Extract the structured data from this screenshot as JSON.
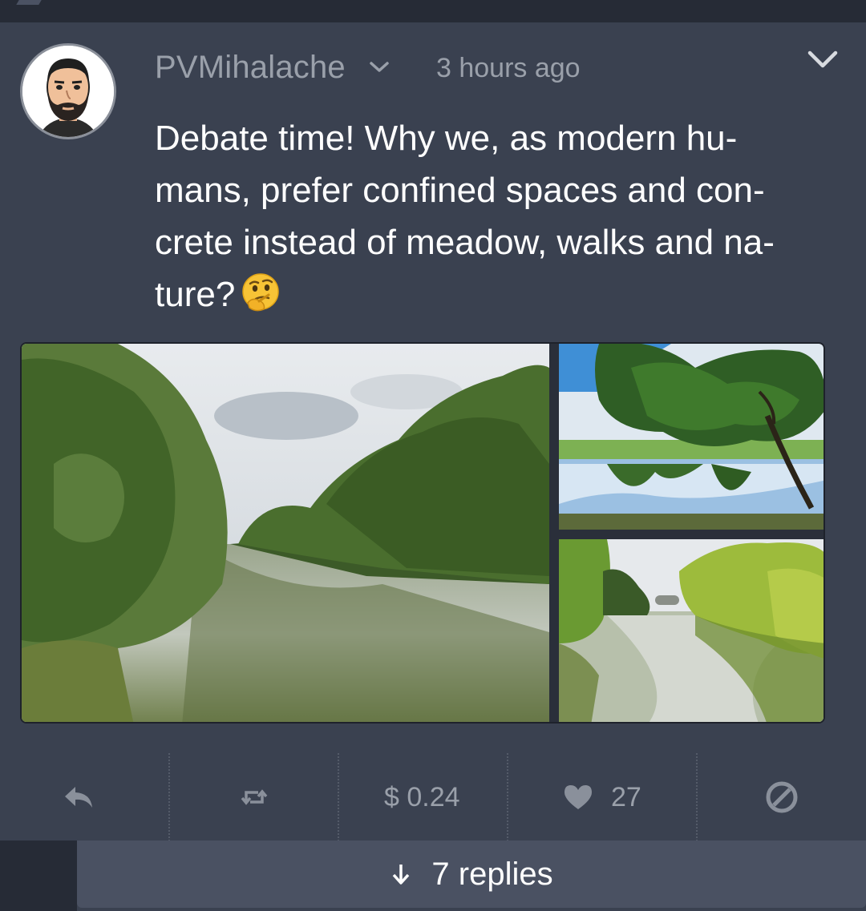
{
  "post": {
    "author": "PVMihalache",
    "timestamp": "3 hours ago",
    "text": "Debate time! Why we, as modern hu-mans, prefer confined spaces and con-crete instead of meadow, walks and na-ture?",
    "text_lines": [
      "Debate time! Why we, as modern hu-",
      "mans, prefer confined spaces and con-",
      "crete instead of meadow, walks and na-",
      "ture?"
    ],
    "emoji": "thinking-face",
    "images": [
      "river-with-trees",
      "pond-with-tree-reflection",
      "willow-trees-by-river"
    ]
  },
  "actions": {
    "reply_icon": "reply-icon",
    "repost_icon": "repost-icon",
    "amount": "$ 0.24",
    "like_icon": "heart-icon",
    "likes": "27",
    "flag_icon": "block-icon"
  },
  "replies": {
    "label": "7 replies",
    "icon": "arrow-down-icon"
  },
  "colors": {
    "background": "#3a4150",
    "muted_text": "#9aa0aa",
    "replies_bar": "#4a5162"
  }
}
